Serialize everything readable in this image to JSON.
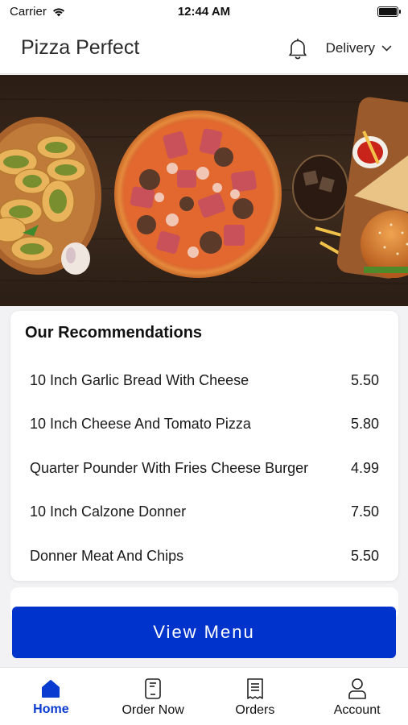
{
  "status_bar": {
    "carrier": "Carrier",
    "time": "12:44 AM"
  },
  "header": {
    "title": "Pizza Perfect",
    "delivery_mode": "Delivery",
    "icons": [
      "bell-icon",
      "chevron-down-icon"
    ]
  },
  "hero": {
    "image": "pizza-spread-banner"
  },
  "recommendations": {
    "title": "Our Recommendations",
    "items": [
      {
        "name": "10 Inch Garlic Bread With Cheese",
        "price": "5.50"
      },
      {
        "name": "10 Inch Cheese And Tomato Pizza",
        "price": "5.80"
      },
      {
        "name": "Quarter Pounder With Fries Cheese Burger",
        "price": "4.99"
      },
      {
        "name": "10 Inch Calzone Donner",
        "price": "7.50"
      },
      {
        "name": "Donner Meat And Chips",
        "price": "5.50"
      }
    ]
  },
  "view_menu_label": "View Menu",
  "tabs": [
    {
      "label": "Home",
      "icon": "home-icon",
      "active": true
    },
    {
      "label": "Order Now",
      "icon": "order-icon",
      "active": false
    },
    {
      "label": "Orders",
      "icon": "receipt-icon",
      "active": false
    },
    {
      "label": "Account",
      "icon": "user-icon",
      "active": false
    }
  ],
  "colors": {
    "accent": "#0033cc",
    "active_tab": "#0a3bd1",
    "background": "#f2f2f4"
  }
}
